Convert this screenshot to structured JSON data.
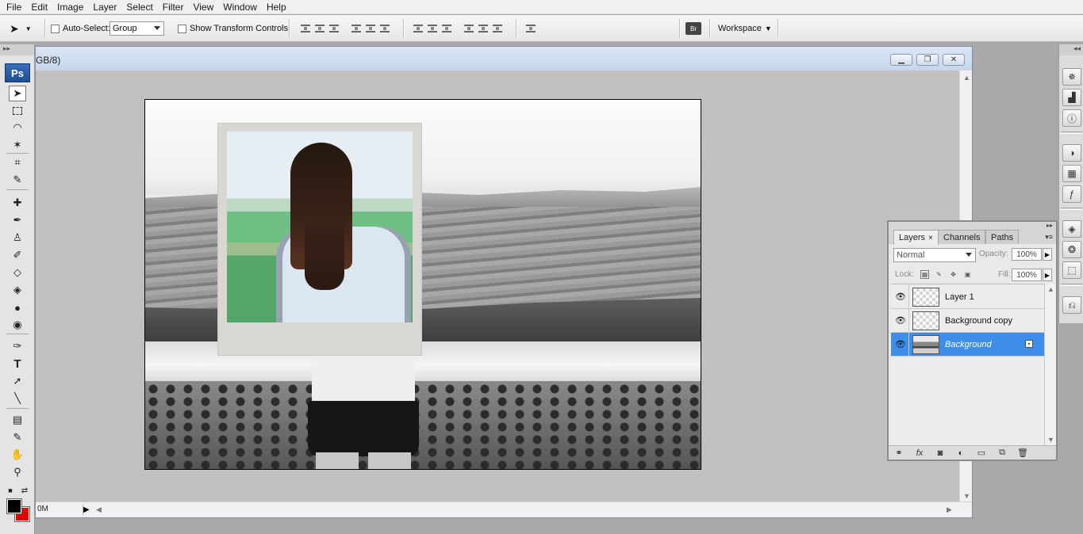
{
  "menubar": {
    "items": [
      "File",
      "Edit",
      "Image",
      "Layer",
      "Select",
      "Filter",
      "View",
      "Window",
      "Help"
    ]
  },
  "options": {
    "move_tool_icon": "move-arrow-icon",
    "auto_select_label": "Auto-Select:",
    "auto_select_checked": false,
    "auto_select_value": "Group",
    "show_transform_label": "Show Transform Controls",
    "show_transform_checked": false,
    "bridge_icon": "bridge-icon",
    "workspace_label": "Workspace"
  },
  "toolbox": {
    "logo": "Ps",
    "tools": [
      "move-tool-icon",
      "marquee-tool-icon",
      "lasso-tool-icon",
      "magic-wand-icon",
      "crop-tool-icon",
      "slice-tool-icon",
      "healing-brush-icon",
      "brush-tool-icon",
      "clone-stamp-icon",
      "history-brush-icon",
      "eraser-icon",
      "paint-bucket-icon",
      "blur-tool-icon",
      "dodge-tool-icon",
      "pen-tool-icon",
      "type-tool-icon",
      "path-select-icon",
      "line-tool-icon",
      "notes-tool-icon",
      "eyedropper-icon",
      "hand-tool-icon",
      "zoom-tool-icon"
    ],
    "foreground_color": "#000000",
    "background_color": "#e00000"
  },
  "document": {
    "title": "GB/8)",
    "zoom_text": "0M"
  },
  "dock": {
    "icons": [
      "navigator-icon",
      "histogram-icon",
      "info-icon",
      "color-icon",
      "swatches-icon",
      "styles-icon",
      "layers-icon",
      "channels-icon",
      "paths-icon",
      "history-icon"
    ]
  },
  "layers_panel": {
    "tabs": [
      "Layers",
      "Channels",
      "Paths"
    ],
    "active_tab": "Layers",
    "blend_mode": "Normal",
    "opacity_label": "Opacity:",
    "opacity_value": "100%",
    "lock_label": "Lock:",
    "fill_label": "Fill:",
    "fill_value": "100%",
    "layers": [
      {
        "name": "Layer 1",
        "visible": true,
        "selected": false,
        "locked": false
      },
      {
        "name": "Background copy",
        "visible": true,
        "selected": false,
        "locked": false
      },
      {
        "name": "Background",
        "visible": true,
        "selected": true,
        "locked": true
      }
    ],
    "bottom_buttons": [
      "link-layers-icon",
      "fx-icon",
      "mask-icon",
      "adjustment-layer-icon",
      "group-folder-icon",
      "new-layer-icon",
      "trash-icon"
    ]
  }
}
